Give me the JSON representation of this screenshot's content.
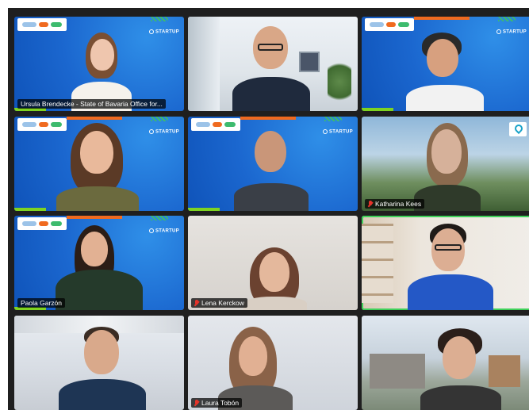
{
  "meeting": {
    "participants": [
      {
        "name": "Ursula Brendecke - State of Bavaria Office for...",
        "muted": false,
        "background": "branded"
      },
      {
        "name": "",
        "muted": false,
        "background": "office"
      },
      {
        "name": "",
        "muted": false,
        "background": "branded"
      },
      {
        "name": "",
        "muted": false,
        "background": "branded"
      },
      {
        "name": "",
        "muted": false,
        "background": "branded"
      },
      {
        "name": "Katharina Kees",
        "muted": true,
        "background": "mountains"
      },
      {
        "name": "Paola Garzón",
        "muted": false,
        "background": "branded"
      },
      {
        "name": "Lena Kerckow",
        "muted": true,
        "background": "room"
      },
      {
        "name": "",
        "muted": false,
        "background": "shelf",
        "active_speaker": true
      },
      {
        "name": "",
        "muted": false,
        "background": "office"
      },
      {
        "name": "Laura Tobón",
        "muted": true,
        "background": "room"
      },
      {
        "name": "",
        "muted": false,
        "background": "street"
      }
    ],
    "brand_text": "STARTUP",
    "colors": {
      "active_speaker": "#3fd15a",
      "brand_blue": "#1b67cf",
      "muted_icon": "#e5332a"
    }
  }
}
